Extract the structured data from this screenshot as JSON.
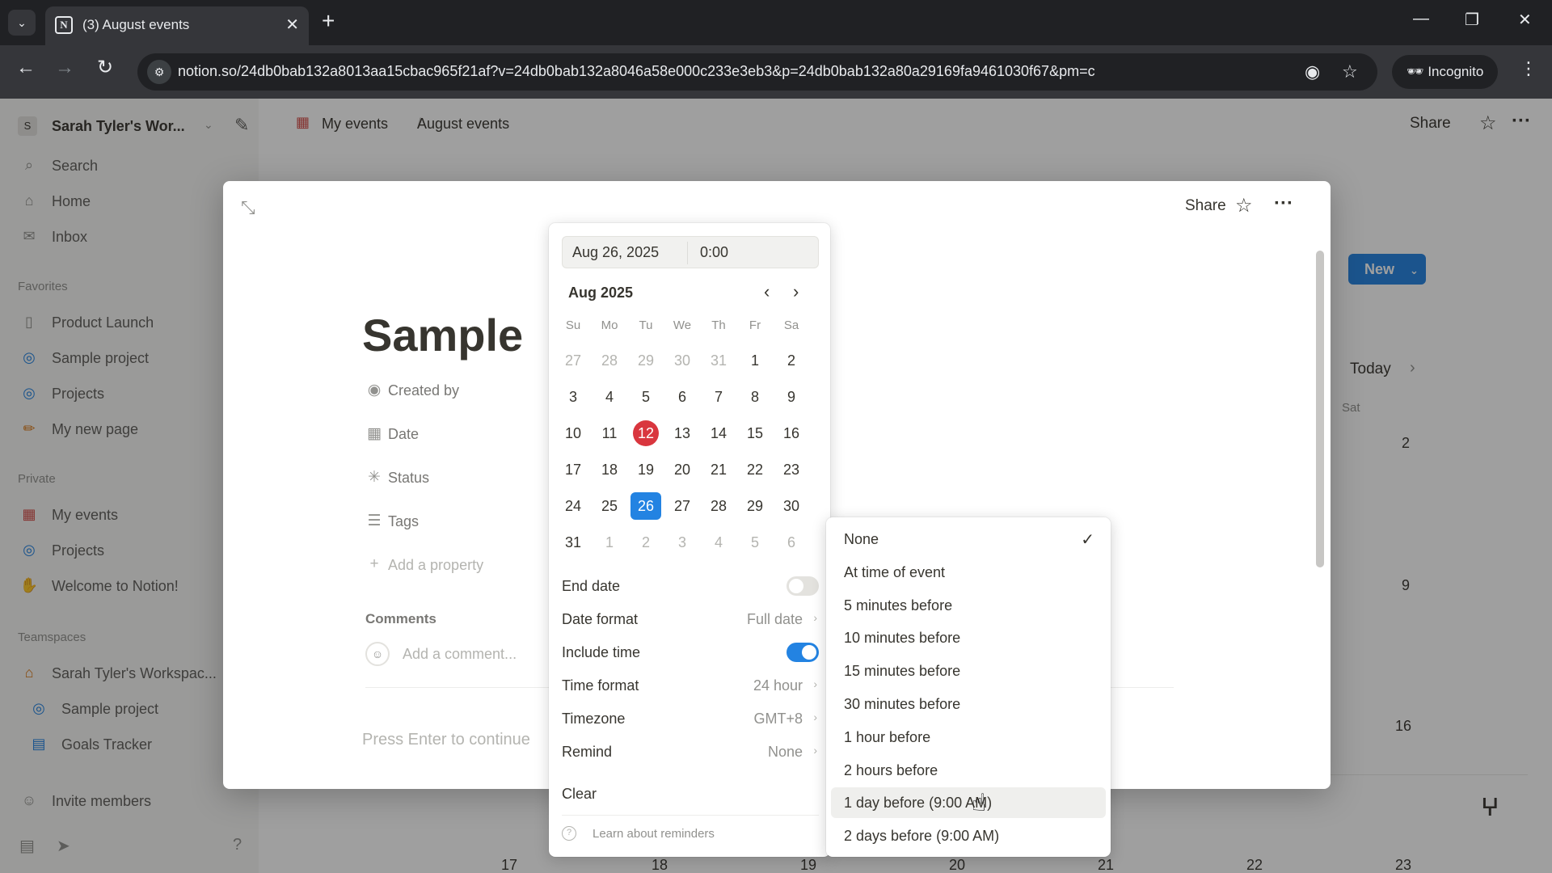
{
  "browser": {
    "tab_title": "(3) August events",
    "tab_favicon": "N",
    "url": "notion.so/24db0bab132a8013aa15cbac965f21af?v=24db0bab132a8046a58e000c233e3eb3&p=24db0bab132a80a29169fa9461030f67&pm=c",
    "incognito_label": "Incognito"
  },
  "workspace": {
    "avatar_letter": "S",
    "name": "Sarah Tyler's Wor..."
  },
  "sidebar": {
    "top_items": [
      {
        "label": "Search",
        "icon": "search-icon"
      },
      {
        "label": "Home",
        "icon": "home-icon"
      },
      {
        "label": "Inbox",
        "icon": "inbox-icon"
      }
    ],
    "favorites_heading": "Favorites",
    "favorites": [
      {
        "label": "Product Launch",
        "icon": "page-icon"
      },
      {
        "label": "Sample project",
        "icon": "project-icon"
      },
      {
        "label": "Projects",
        "icon": "project-icon"
      },
      {
        "label": "My new page",
        "icon": "pencil-icon"
      }
    ],
    "private_heading": "Private",
    "private": [
      {
        "label": "My events",
        "icon": "calendar-icon"
      },
      {
        "label": "Projects",
        "icon": "project-icon"
      },
      {
        "label": "Welcome to Notion!",
        "icon": "wave-icon"
      }
    ],
    "teamspaces_heading": "Teamspaces",
    "teamspaces": [
      {
        "label": "Sarah Tyler's Workspac...",
        "icon": "house-icon"
      },
      {
        "label": "Sample project",
        "icon": "project-icon"
      },
      {
        "label": "Goals Tracker",
        "icon": "chart-icon"
      }
    ],
    "invite_label": "Invite members"
  },
  "topbar": {
    "breadcrumb_parent": "My events",
    "breadcrumb_current": "August events",
    "share_label": "Share"
  },
  "background_db": {
    "new_label": "New",
    "today_label": "Today",
    "sat_label": "Sat",
    "right_numbers": [
      "2",
      "9",
      "16"
    ],
    "bottom_numbers": [
      "17",
      "18",
      "19",
      "20",
      "21",
      "22",
      "23"
    ]
  },
  "modal": {
    "share_label": "Share",
    "title": "Sample",
    "properties": [
      {
        "label": "Created by",
        "icon": "person-circle-icon"
      },
      {
        "label": "Date",
        "icon": "calendar-icon"
      },
      {
        "label": "Status",
        "icon": "status-icon"
      },
      {
        "label": "Tags",
        "icon": "list-icon"
      }
    ],
    "add_property_label": "Add a property",
    "comments_heading": "Comments",
    "comment_placeholder": "Add a comment...",
    "body_placeholder": "Press Enter to continue"
  },
  "datepicker": {
    "date_value": "Aug 26, 2025",
    "time_value": "0:00",
    "month_label": "Aug 2025",
    "weekdays": [
      "Su",
      "Mo",
      "Tu",
      "We",
      "Th",
      "Fr",
      "Sa"
    ],
    "weeks": [
      [
        "27",
        "28",
        "29",
        "30",
        "31",
        "1",
        "2"
      ],
      [
        "3",
        "4",
        "5",
        "6",
        "7",
        "8",
        "9"
      ],
      [
        "10",
        "11",
        "12",
        "13",
        "14",
        "15",
        "16"
      ],
      [
        "17",
        "18",
        "19",
        "20",
        "21",
        "22",
        "23"
      ],
      [
        "24",
        "25",
        "26",
        "27",
        "28",
        "29",
        "30"
      ],
      [
        "31",
        "1",
        "2",
        "3",
        "4",
        "5",
        "6"
      ]
    ],
    "today_day": "12",
    "selected_day": "26",
    "end_date_label": "End date",
    "end_date_on": false,
    "date_format_label": "Date format",
    "date_format_value": "Full date",
    "include_time_label": "Include time",
    "include_time_on": true,
    "time_format_label": "Time format",
    "time_format_value": "24 hour",
    "timezone_label": "Timezone",
    "timezone_value": "GMT+8",
    "remind_label": "Remind",
    "remind_value": "None",
    "clear_label": "Clear",
    "learn_label": "Learn about reminders"
  },
  "remind_menu": {
    "options": [
      "None",
      "At time of event",
      "5 minutes before",
      "10 minutes before",
      "15 minutes before",
      "30 minutes before",
      "1 hour before",
      "2 hours before",
      "1 day before (9:00 AM)",
      "2 days before (9:00 AM)"
    ],
    "checked_option": "None",
    "hovered_option": "1 day before (9:00 AM)"
  },
  "colors": {
    "accent": "#2383e2",
    "today": "#d9363e",
    "text": "#37352f"
  }
}
